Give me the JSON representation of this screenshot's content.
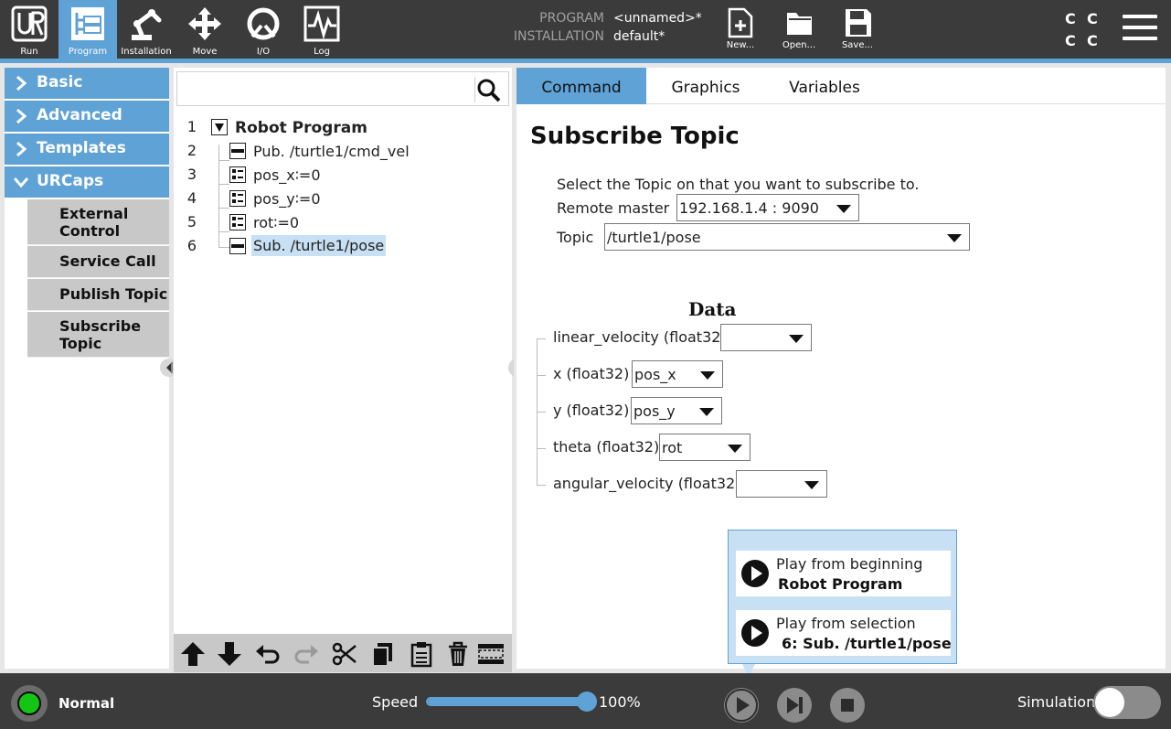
{
  "header": {
    "nav": [
      {
        "label": "Run",
        "icon": "ur-logo-icon"
      },
      {
        "label": "Program",
        "icon": "program-icon"
      },
      {
        "label": "Installation",
        "icon": "robot-arm-icon"
      },
      {
        "label": "Move",
        "icon": "move-icon"
      },
      {
        "label": "I/O",
        "icon": "io-icon"
      },
      {
        "label": "Log",
        "icon": "log-icon"
      }
    ],
    "program_label": "PROGRAM",
    "program_value": "<unnamed>*",
    "installation_label": "INSTALLATION",
    "installation_value": "default*",
    "file_buttons": [
      {
        "label": "New...",
        "icon": "new-file-icon"
      },
      {
        "label": "Open...",
        "icon": "folder-icon"
      },
      {
        "label": "Save...",
        "icon": "save-icon"
      }
    ],
    "cc": [
      "C",
      "C",
      "C",
      "C"
    ],
    "accent_color": "#5ea2d6"
  },
  "sidebar": {
    "categories": [
      {
        "label": "Basic",
        "expanded": false
      },
      {
        "label": "Advanced",
        "expanded": false
      },
      {
        "label": "Templates",
        "expanded": false
      },
      {
        "label": "URCaps",
        "expanded": true
      }
    ],
    "urcaps_items": [
      {
        "line1": "External",
        "line2": "Control"
      },
      {
        "line1": "Service Call",
        "line2": ""
      },
      {
        "line1": "Publish Topic",
        "line2": ""
      },
      {
        "line1": "Subscribe",
        "line2": "Topic"
      }
    ]
  },
  "tree": {
    "search_placeholder": "",
    "nodes": [
      {
        "line": "1",
        "text": "Robot Program"
      },
      {
        "line": "2",
        "text": "Pub. /turtle1/cmd_vel"
      },
      {
        "line": "3",
        "text": "pos_x∶=0"
      },
      {
        "line": "4",
        "text": "pos_y∶=0"
      },
      {
        "line": "5",
        "text": "rot∶=0"
      },
      {
        "line": "6",
        "text": "Sub. /turtle1/pose"
      }
    ],
    "selected_line": "6",
    "toolbar": [
      "move-up-icon",
      "move-down-icon",
      "undo-icon",
      "redo-icon",
      "cut-icon",
      "copy-icon",
      "paste-icon",
      "delete-icon",
      "suppress-icon"
    ]
  },
  "panel": {
    "tabs": [
      "Command",
      "Graphics",
      "Variables"
    ],
    "active_tab": "Command",
    "title": "Subscribe Topic",
    "instruction": "Select the Topic on that you want to subscribe to.",
    "remote_master_label": "Remote master",
    "remote_master_value": "192.168.1.4 : 9090",
    "topic_label": "Topic",
    "topic_value": "/turtle1/pose",
    "data_title": "Data",
    "data_fields": [
      {
        "label": "linear_velocity (float32)",
        "value": ""
      },
      {
        "label": "x (float32)",
        "value": "pos_x"
      },
      {
        "label": "y (float32)",
        "value": "pos_y"
      },
      {
        "label": "theta (float32)",
        "value": "rot"
      },
      {
        "label": "angular_velocity (float32)",
        "value": ""
      }
    ]
  },
  "play_popup": {
    "option1_line1": "Play from beginning",
    "option1_line2": "Robot Program",
    "option2_line1": "Play from selection",
    "option2_line2": "6: Sub. /turtle1/pose"
  },
  "footer": {
    "status": "Normal",
    "status_color": "#15c515",
    "speed_label": "Speed",
    "speed_value": "100%",
    "speed_fraction": 1.0,
    "controls": [
      "play-icon",
      "step-icon",
      "stop-icon"
    ],
    "simulation_label": "Simulation",
    "simulation_on": false
  }
}
